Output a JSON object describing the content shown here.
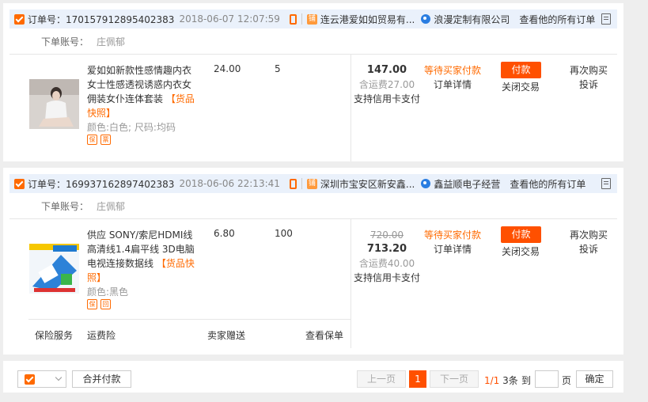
{
  "orders": [
    {
      "order_no": "订单号：170157912895402383",
      "time": "2018-06-07 12:07:59",
      "shop_name": "连云港爱如如贸易有...",
      "seller": "浪漫定制有限公司",
      "all_orders": "查看他的所有订单",
      "account_label": "下单账号：",
      "account": "庄佩郁",
      "product_name": "爱如如新款性感情趣内衣女士性感透视诱惑内衣女佣装女仆连体套装",
      "snapshot": "【货品快照】",
      "spec": "颜色:白色;  尺码:均码",
      "unit_price": "24.00",
      "quantity": "5",
      "total": "147.00",
      "shipping": "含运费27.00",
      "payment": "支持信用卡支付",
      "status": "等待买家付款",
      "detail": "订单详情",
      "pay_btn": "付款",
      "close": "关闭交易",
      "rebuy": "再次购买",
      "complain": "投诉"
    },
    {
      "order_no": "订单号：169937162897402383",
      "time": "2018-06-06 22:13:41",
      "shop_name": "深圳市宝安区新安鑫...",
      "seller": "鑫益顺电子经营",
      "all_orders": "查看他的所有订单",
      "account_label": "下单账号：",
      "account": "庄佩郁",
      "product_name": "供应 SONY/索尼HDMI线 高清线1.4扁平线 3D电脑电视连接数据线",
      "snapshot": "【货品快照】",
      "spec": "颜色:黑色",
      "unit_price": "6.80",
      "quantity": "100",
      "original_total": "720.00",
      "total": "713.20",
      "shipping": "含运费40.00",
      "payment": "支持信用卡支付",
      "status": "等待买家付款",
      "detail": "订单详情",
      "pay_btn": "付款",
      "close": "关闭交易",
      "rebuy": "再次购买",
      "complain": "投诉",
      "services": [
        "保险服务",
        "运费险",
        "卖家赠送",
        "查看保单"
      ]
    }
  ],
  "pager": {
    "merge_pay": "合并付款",
    "prev": "上一页",
    "current": "1",
    "next": "下一页",
    "page_info": "1/1",
    "count": "3条",
    "goto": "到",
    "page_unit": "页",
    "confirm": "确定"
  },
  "colors": {
    "accent": "#ff6a00",
    "header_bg": "#eaf1fb",
    "pay_button": "#ff5000"
  }
}
